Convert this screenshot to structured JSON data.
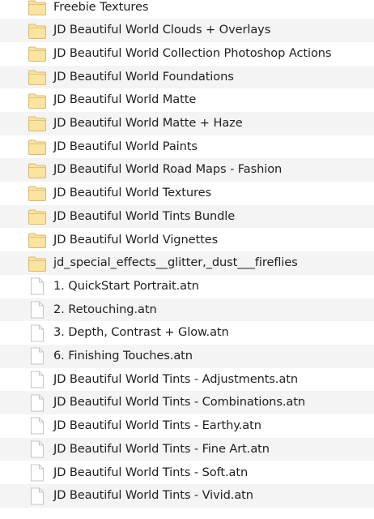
{
  "items": [
    {
      "type": "folder",
      "icon": "folder-icon",
      "name": "Freebie Textures"
    },
    {
      "type": "folder",
      "icon": "folder-icon",
      "name": "JD Beautiful World Clouds + Overlays"
    },
    {
      "type": "folder",
      "icon": "folder-icon",
      "name": "JD Beautiful World Collection Photoshop Actions"
    },
    {
      "type": "folder",
      "icon": "folder-icon",
      "name": "JD Beautiful World Foundations"
    },
    {
      "type": "folder",
      "icon": "folder-icon",
      "name": "JD Beautiful World Matte"
    },
    {
      "type": "folder",
      "icon": "folder-icon",
      "name": "JD Beautiful World Matte + Haze"
    },
    {
      "type": "folder",
      "icon": "folder-icon",
      "name": "JD Beautiful World Paints"
    },
    {
      "type": "folder",
      "icon": "folder-icon",
      "name": "JD Beautiful World Road Maps - Fashion"
    },
    {
      "type": "folder",
      "icon": "folder-icon",
      "name": "JD Beautiful World Textures"
    },
    {
      "type": "folder",
      "icon": "folder-icon",
      "name": "JD Beautiful World Tints Bundle"
    },
    {
      "type": "folder",
      "icon": "folder-icon",
      "name": "JD Beautiful World Vignettes"
    },
    {
      "type": "folder",
      "icon": "folder-icon",
      "name": "jd_special_effects__glitter,_dust___fireflies"
    },
    {
      "type": "file",
      "icon": "document-icon",
      "name": "1. QuickStart Portrait.atn"
    },
    {
      "type": "file",
      "icon": "document-icon",
      "name": "2. Retouching.atn"
    },
    {
      "type": "file",
      "icon": "document-icon",
      "name": "3. Depth, Contrast + Glow.atn"
    },
    {
      "type": "file",
      "icon": "document-icon",
      "name": "6. Finishing Touches.atn"
    },
    {
      "type": "file",
      "icon": "document-icon",
      "name": "JD Beautiful World Tints - Adjustments.atn"
    },
    {
      "type": "file",
      "icon": "document-icon",
      "name": "JD Beautiful World Tints - Combinations.atn"
    },
    {
      "type": "file",
      "icon": "document-icon",
      "name": "JD Beautiful World Tints - Earthy.atn"
    },
    {
      "type": "file",
      "icon": "document-icon",
      "name": "JD Beautiful World Tints - Fine Art.atn"
    },
    {
      "type": "file",
      "icon": "document-icon",
      "name": "JD Beautiful World Tints - Soft.atn"
    },
    {
      "type": "file",
      "icon": "document-icon",
      "name": "JD Beautiful World Tints - Vivid.atn"
    }
  ],
  "colors": {
    "folder_fill": "#fbe3a0",
    "folder_stroke": "#d9b86a",
    "doc_fill": "#ffffff",
    "doc_stroke": "#c4c4c4",
    "row_alt": "#f4f4f4"
  }
}
